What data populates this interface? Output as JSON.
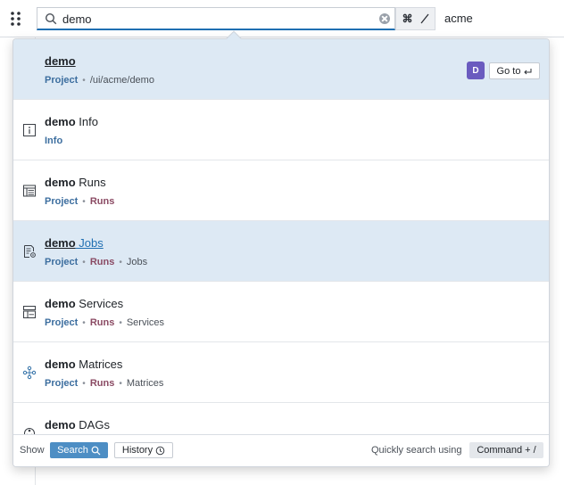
{
  "search": {
    "value": "demo",
    "placeholder": ""
  },
  "shortcut": {
    "cmd": "⌘",
    "slash": "/"
  },
  "org": {
    "name": "acme"
  },
  "results": [
    {
      "title_bold": "demo",
      "title_rest": "",
      "meta": [
        {
          "text": "Project",
          "kind": "project"
        },
        {
          "text": "/ui/acme/demo",
          "kind": "plain"
        }
      ],
      "avatar": "D",
      "goto_label": "Go to",
      "icon": "project-icon"
    },
    {
      "title_bold": "demo",
      "title_rest": " Info",
      "meta": [
        {
          "text": "Info",
          "kind": "info"
        }
      ],
      "icon": "info-icon"
    },
    {
      "title_bold": "demo",
      "title_rest": " Runs",
      "meta": [
        {
          "text": "Project",
          "kind": "project"
        },
        {
          "text": "Runs",
          "kind": "runs"
        }
      ],
      "icon": "runs-table-icon"
    },
    {
      "title_bold": "demo",
      "title_rest": " Jobs",
      "meta": [
        {
          "text": "Project",
          "kind": "project"
        },
        {
          "text": "Runs",
          "kind": "runs"
        },
        {
          "text": "Jobs",
          "kind": "plain"
        }
      ],
      "icon": "jobs-icon"
    },
    {
      "title_bold": "demo",
      "title_rest": " Services",
      "meta": [
        {
          "text": "Project",
          "kind": "project"
        },
        {
          "text": "Runs",
          "kind": "runs"
        },
        {
          "text": "Services",
          "kind": "plain"
        }
      ],
      "icon": "services-icon"
    },
    {
      "title_bold": "demo",
      "title_rest": " Matrices",
      "meta": [
        {
          "text": "Project",
          "kind": "project"
        },
        {
          "text": "Runs",
          "kind": "runs"
        },
        {
          "text": "Matrices",
          "kind": "plain"
        }
      ],
      "icon": "matrices-icon"
    },
    {
      "title_bold": "demo",
      "title_rest": " DAGs",
      "meta": [],
      "icon": "dags-icon"
    }
  ],
  "footer": {
    "show_label": "Show",
    "search_label": "Search",
    "history_label": "History",
    "quick_label": "Quickly search using",
    "command_label": "Command + /"
  }
}
